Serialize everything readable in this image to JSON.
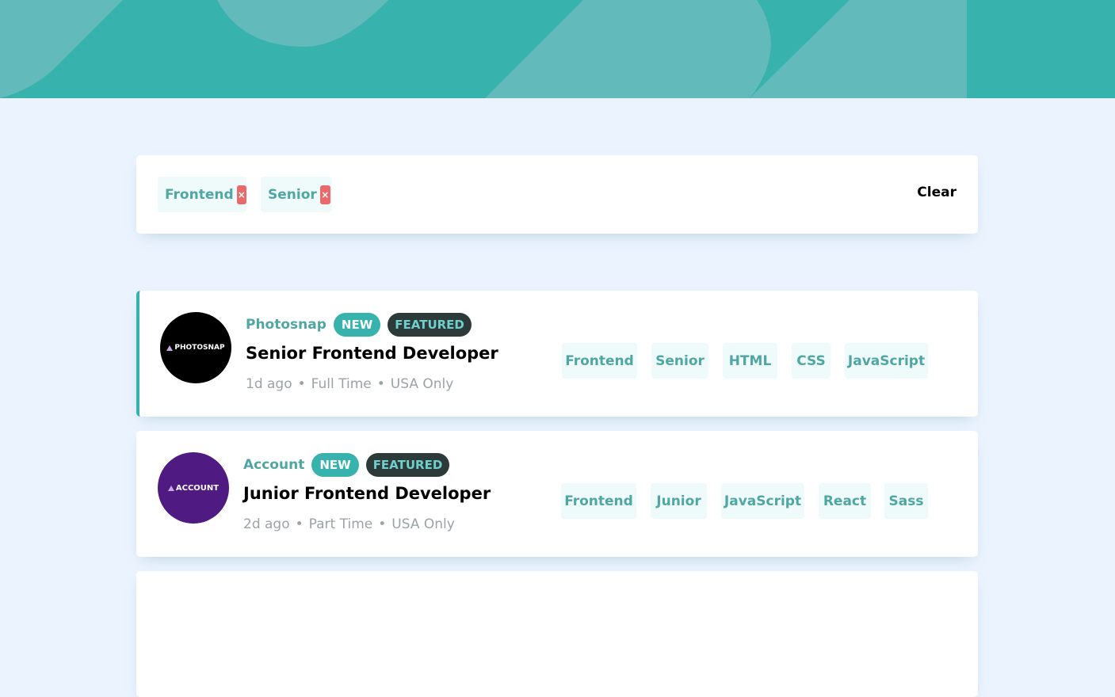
{
  "colors": {
    "accent": "#37b2ad",
    "background": "#ebf3fe",
    "remove": "#e86a6a"
  },
  "filters": {
    "chips": [
      {
        "label": "Frontend",
        "remove_icon": "×"
      },
      {
        "label": "Senior",
        "remove_icon": "×"
      }
    ],
    "clear_label": "Clear"
  },
  "jobs": [
    {
      "logo_text": "PHOTOSNAP",
      "company": "Photosnap",
      "new_label": "NEW",
      "featured_label": "FEATURED",
      "position": "Senior Frontend Developer",
      "posted": "1d ago",
      "contract": "Full Time",
      "location": "USA Only",
      "separator": "•",
      "tags": [
        "Frontend",
        "Senior",
        "HTML",
        "CSS",
        "JavaScript"
      ]
    },
    {
      "logo_text": "ACCOUNT",
      "company": "Account",
      "new_label": "NEW",
      "featured_label": "FEATURED",
      "position": "Junior Frontend Developer",
      "posted": "2d ago",
      "contract": "Part Time",
      "location": "USA Only",
      "separator": "•",
      "tags": [
        "Frontend",
        "Junior",
        "JavaScript",
        "React",
        "Sass"
      ]
    }
  ]
}
